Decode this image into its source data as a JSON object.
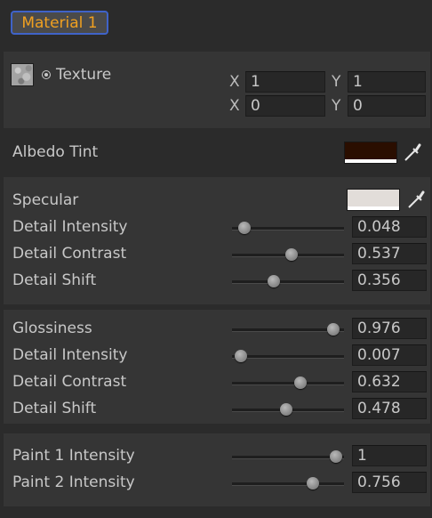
{
  "material_button": "Material 1",
  "texture": {
    "label": "Texture",
    "tiling_x_axis": "X",
    "tiling_x": "1",
    "tiling_y_axis": "Y",
    "tiling_y": "1",
    "offset_x_axis": "X",
    "offset_x": "0",
    "offset_y_axis": "Y",
    "offset_y": "0"
  },
  "albedo": {
    "label": "Albedo Tint",
    "color": "#2a0e00"
  },
  "specular": {
    "label": "Specular",
    "color": "#e2ddd9",
    "detail_intensity": {
      "label": "Detail Intensity",
      "value": "0.048",
      "fraction": 0.048
    },
    "detail_contrast": {
      "label": "Detail Contrast",
      "value": "0.537",
      "fraction": 0.537
    },
    "detail_shift": {
      "label": "Detail Shift",
      "value": "0.356",
      "fraction": 0.356
    }
  },
  "glossiness": {
    "label": "Glossiness",
    "value": "0.976",
    "fraction": 0.976,
    "detail_intensity": {
      "label": "Detail Intensity",
      "value": "0.007",
      "fraction": 0.007
    },
    "detail_contrast": {
      "label": "Detail Contrast",
      "value": "0.632",
      "fraction": 0.632
    },
    "detail_shift": {
      "label": "Detail Shift",
      "value": "0.478",
      "fraction": 0.478
    }
  },
  "paint": {
    "paint1": {
      "label": "Paint 1 Intensity",
      "value": "1",
      "fraction": 1.0
    },
    "paint2": {
      "label": "Paint 2 Intensity",
      "value": "0.756",
      "fraction": 0.756
    }
  }
}
